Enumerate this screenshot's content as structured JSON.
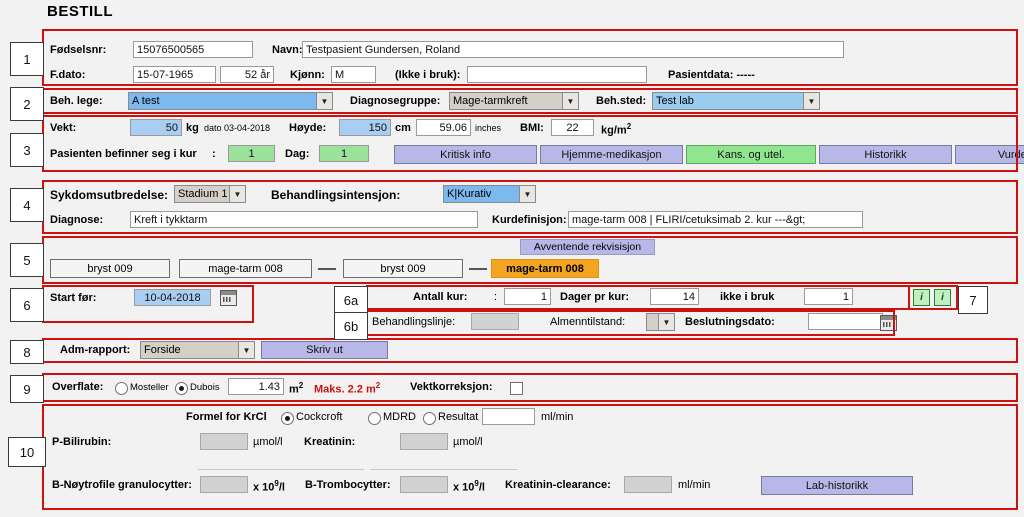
{
  "page_title": "BESTILL",
  "markers": [
    "1",
    "2",
    "3",
    "4",
    "5",
    "6",
    "6a",
    "6b",
    "7",
    "8",
    "9",
    "10"
  ],
  "section1": {
    "fodselsnr_label": "Fødselsnr:",
    "fodselsnr_value": "15076500565",
    "navn_label": "Navn:",
    "navn_value": "Testpasient Gundersen, Roland",
    "fdato_label": "F.dato:",
    "fdato_value": "15-07-1965",
    "alder_value": "52 år",
    "kjonn_label": "Kjønn:",
    "kjonn_value": "M",
    "ikkebruk_label": "(Ikke i bruk):",
    "ikkebruk_value": "",
    "pasientdata_label": "Pasientdata: -----"
  },
  "section2": {
    "beh_lege_label": "Beh. lege:",
    "beh_lege_value": "A test",
    "diagnosegruppe_label": "Diagnosegruppe:",
    "diagnosegruppe_value": "Mage-tarmkreft",
    "beh_sted_label": "Beh.sted:",
    "beh_sted_value": "Test lab"
  },
  "section3": {
    "vekt_label": "Vekt:",
    "vekt_value": "50",
    "kg_unit": "kg",
    "vekt_dato": "dato 03-04-2018",
    "hoyde_label": "Høyde:",
    "hoyde_value": "150",
    "cm_unit": "cm",
    "inches_value": "59.06",
    "inches_unit": "inches",
    "bmi_label": "BMI:",
    "bmi_value": "22",
    "bmi_unit_pre": "kg/m",
    "bmi_unit_sup": "2",
    "kur_label": "Pasienten befinner seg i kur",
    "kur_colon": ":",
    "kur_value": "1",
    "dag_label": "Dag:",
    "dag_value": "1",
    "buttons": [
      {
        "label": "Kritisk info",
        "style": "lilac"
      },
      {
        "label": "Hjemme-medikasjon",
        "style": "lilac"
      },
      {
        "label": "Kans. og utel.",
        "style": "green"
      },
      {
        "label": "Historikk",
        "style": "lilac"
      },
      {
        "label": "Vurdering",
        "style": "lilac"
      }
    ]
  },
  "section4": {
    "sykdom_label": "Sykdomsutbredelse:",
    "sykdom_value": "Stadium 1",
    "intensjon_label": "Behandlingsintensjon:",
    "intensjon_value": "K|Kurativ",
    "diagnose_label": "Diagnose:",
    "diagnose_value": "Kreft i tykktarm",
    "kurdef_label": "Kurdefinisjon:",
    "kurdef_value": "mage-tarm 008 | FLIRI/cetuksimab 2. kur ---&gt;"
  },
  "section5": {
    "pending_label": "Avventende rekvisisjon",
    "chips": [
      {
        "label": "bryst 009",
        "style": "plain"
      },
      {
        "label": "mage-tarm 008",
        "style": "plain"
      },
      {
        "label": "bryst 009",
        "style": "plain"
      },
      {
        "label": "mage-tarm 008",
        "style": "orange"
      }
    ]
  },
  "section6": {
    "start_for_label": "Start før:",
    "start_for_value": "10-04-2018",
    "calendar_icon": "calendar-icon"
  },
  "section6a": {
    "antall_kur_label": "Antall kur:",
    "antall_kur_colon": ":",
    "antall_kur_value": "1",
    "dager_pr_kur_label": "Dager pr kur:",
    "dager_pr_kur_value": "14",
    "ikke_i_bruk_label": "ikke i bruk",
    "ikke_i_bruk_value": "1"
  },
  "section6b": {
    "behandlingslinje_label": "Behandlingslinje:",
    "behandlingslinje_value": "",
    "almenntilstand_label": "Almenntilstand:",
    "almenntilstand_value": "",
    "beslutningsdato_label": "Beslutningsdato:",
    "beslutningsdato_value": "",
    "calendar_icon": "calendar-icon"
  },
  "section7": {
    "icons": [
      "info-icon",
      "info-icon"
    ]
  },
  "section8": {
    "adm_rapport_label": "Adm-rapport:",
    "adm_rapport_value": "Forside",
    "skriv_ut_label": "Skriv ut"
  },
  "section9": {
    "overflate_label": "Overflate:",
    "mosteller_label": "Mosteller",
    "mosteller_selected": false,
    "dubois_label": "Dubois",
    "dubois_selected": true,
    "overflate_value": "1.43",
    "m2_pre": "m",
    "m2_sup": "2",
    "maks_label": "Maks. 2.2 m",
    "maks_sup": "2",
    "vektkorreksjon_label": "Vektkorreksjon:",
    "vektkorreksjon_checked": false
  },
  "section10": {
    "formel_label": "Formel for KrCl",
    "cockcroft_label": "Cockcroft",
    "cockcroft_selected": true,
    "mdrd_label": "MDRD",
    "mdrd_selected": false,
    "resultat_label": "Resultat",
    "resultat_selected": false,
    "resultat_value": "",
    "mlmin_unit": "ml/min",
    "bilirubin_label": "P-Bilirubin:",
    "bilirubin_value": "",
    "bilirubin_unit": "µmol/l",
    "kreatinin_label": "Kreatinin:",
    "kreatinin_value": "",
    "kreatinin_unit": "µmol/l",
    "granulocytter_label": "B-Nøytrofile granulocytter:",
    "granulocytter_value": "",
    "granulocytter_unit_pre": "x 10",
    "granulocytter_unit_sup": "9",
    "granulocytter_unit_post": "/l",
    "trombocytter_label": "B-Trombocytter:",
    "trombocytter_value": "",
    "trombocytter_unit_pre": "x 10",
    "trombocytter_unit_sup": "9",
    "trombocytter_unit_post": "/l",
    "clearance_label": "Kreatinin-clearance:",
    "clearance_value": "",
    "clearance_unit": "ml/min",
    "lab_historikk_label": "Lab-historikk"
  },
  "colors": {
    "annotation_red": "#cc1111",
    "field_blue": "#aacdf2",
    "field_green": "#9be39b",
    "button_lilac": "#b8b8e8",
    "button_green": "#8fe68f",
    "chip_orange": "#f4a521",
    "warning_red": "#cc1111"
  }
}
